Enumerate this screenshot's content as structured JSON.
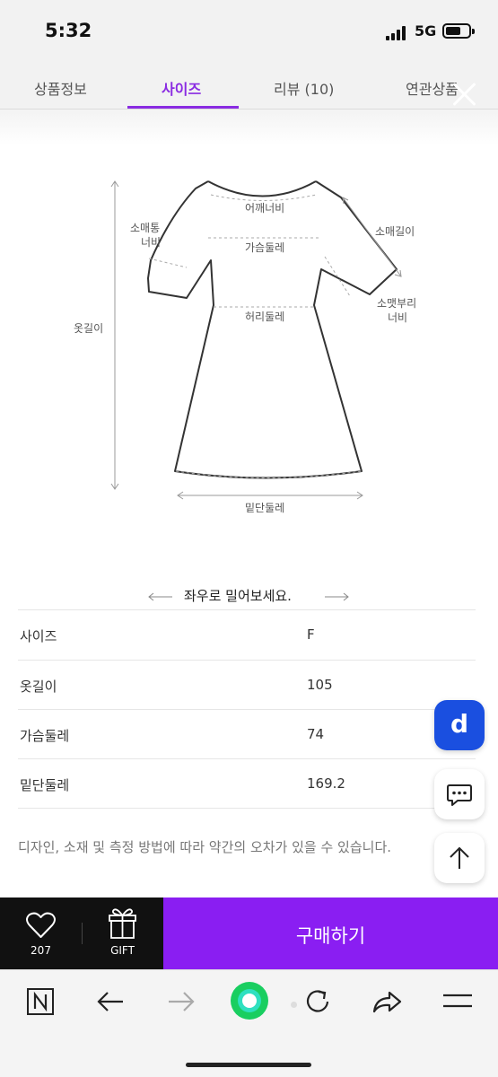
{
  "status": {
    "time": "5:32",
    "network": "5G"
  },
  "tabs": [
    {
      "label": "상품정보",
      "active": false
    },
    {
      "label": "사이즈",
      "active": true
    },
    {
      "label": "리뷰 (10)",
      "active": false
    },
    {
      "label": "연관상품",
      "active": false
    }
  ],
  "diagram_labels": {
    "shoulder": "어깨너비",
    "chest": "가슴둘레",
    "waist": "허리둘레",
    "hem": "밑단둘레",
    "length": "옷길이",
    "sleeve_width_1": "소매통",
    "sleeve_width_2": "너비",
    "sleeve_length": "소매길이",
    "cuff_1": "소맷부리",
    "cuff_2": "너비"
  },
  "swipe_hint": "좌우로 밀어보세요.",
  "size_table": [
    {
      "label": "사이즈",
      "value": "F"
    },
    {
      "label": "옷길이",
      "value": "105"
    },
    {
      "label": "가슴둘레",
      "value": "74"
    },
    {
      "label": "밑단둘레",
      "value": "169.2"
    }
  ],
  "note": "디자인, 소재 및 측정 방법에 따라 약간의 오차가 있을 수 있습니다.",
  "floating": {
    "d_label": "d"
  },
  "buybar": {
    "like_count": "207",
    "gift_label": "GIFT",
    "buy_label": "구매하기"
  },
  "colors": {
    "accent": "#8a1ef2",
    "tab_active": "#8a2be2",
    "d_button": "#1a4fe0",
    "naver_green": "#19ce60"
  },
  "toolbar_icons": [
    "naver-n-icon",
    "back-arrow-icon",
    "forward-arrow-icon",
    "green-circle-icon",
    "reload-icon",
    "share-icon",
    "menu-icon"
  ]
}
